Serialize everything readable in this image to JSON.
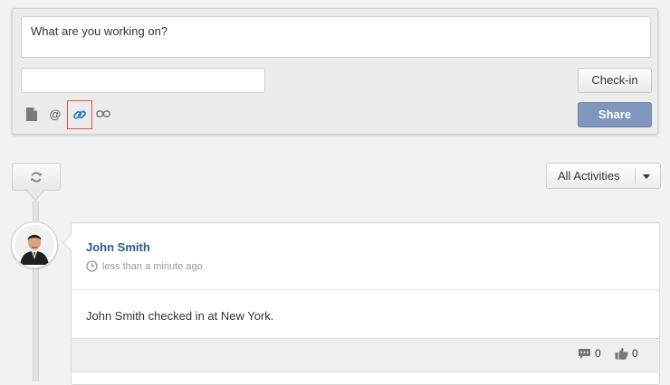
{
  "composer": {
    "status_placeholder": "What are you working on?",
    "location_value": "",
    "checkin_label": "Check-in",
    "share_label": "Share",
    "tools": {
      "file": "file-icon",
      "mention_symbol": "@",
      "link": "link-icon",
      "unlink": "unlink-icon"
    }
  },
  "feed": {
    "refresh_icon": "refresh-icon",
    "filter_label": "All Activities"
  },
  "activity": {
    "author": "John Smith",
    "time": "less than a minute ago",
    "message": "John Smith checked in at New York.",
    "comments": "0",
    "likes": "0"
  },
  "colors": {
    "accent": "#7f96bd",
    "link": "#2b5b8e",
    "highlight_border": "#d9534f"
  }
}
